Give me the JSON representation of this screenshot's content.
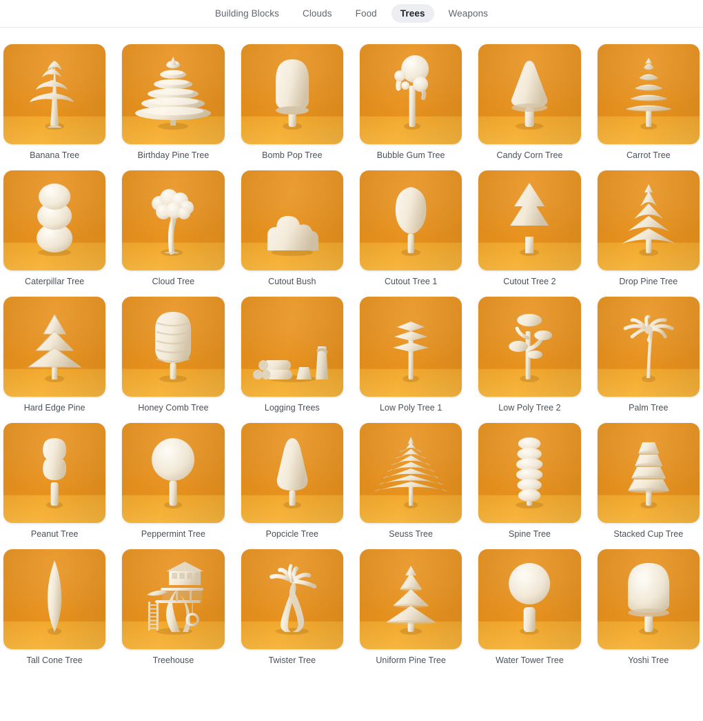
{
  "tabs": [
    {
      "label": "Building Blocks",
      "active": false
    },
    {
      "label": "Clouds",
      "active": false
    },
    {
      "label": "Food",
      "active": false
    },
    {
      "label": "Trees",
      "active": true
    },
    {
      "label": "Weapons",
      "active": false
    }
  ],
  "colors": {
    "thumb_back_wall": "#e8921e",
    "thumb_floor": "#f7b63f",
    "object_cream": "#f2e8d5",
    "active_tab_bg": "#eceef1",
    "active_tab_text": "#1d2129",
    "tab_text": "#5f6672",
    "caption_text": "#4a5057",
    "page_bg": "#ffffff",
    "divider": "#e9eaec"
  },
  "grid": {
    "columns": 6,
    "rows": 5,
    "count": 30,
    "items": [
      {
        "label": "Banana Tree",
        "icon": "banana-tree-3d-render"
      },
      {
        "label": "Birthday Pine Tree",
        "icon": "birthday-pine-tree-3d-render"
      },
      {
        "label": "Bomb Pop Tree",
        "icon": "bomb-pop-tree-3d-render"
      },
      {
        "label": "Bubble Gum Tree",
        "icon": "bubble-gum-tree-3d-render"
      },
      {
        "label": "Candy Corn Tree",
        "icon": "candy-corn-tree-3d-render"
      },
      {
        "label": "Carrot Tree",
        "icon": "carrot-tree-3d-render"
      },
      {
        "label": "Caterpillar Tree",
        "icon": "caterpillar-tree-3d-render"
      },
      {
        "label": "Cloud Tree",
        "icon": "cloud-tree-3d-render"
      },
      {
        "label": "Cutout Bush",
        "icon": "cutout-bush-3d-render"
      },
      {
        "label": "Cutout Tree 1",
        "icon": "cutout-tree-1-3d-render"
      },
      {
        "label": "Cutout Tree 2",
        "icon": "cutout-tree-2-3d-render"
      },
      {
        "label": "Drop Pine Tree",
        "icon": "drop-pine-tree-3d-render"
      },
      {
        "label": "Hard Edge Pine",
        "icon": "hard-edge-pine-3d-render"
      },
      {
        "label": "Honey Comb Tree",
        "icon": "honey-comb-tree-3d-render"
      },
      {
        "label": "Logging Trees",
        "icon": "logging-trees-3d-render"
      },
      {
        "label": "Low Poly Tree 1",
        "icon": "low-poly-tree-1-3d-render"
      },
      {
        "label": "Low Poly Tree 2",
        "icon": "low-poly-tree-2-3d-render"
      },
      {
        "label": "Palm Tree",
        "icon": "palm-tree-3d-render"
      },
      {
        "label": "Peanut Tree",
        "icon": "peanut-tree-3d-render"
      },
      {
        "label": "Peppermint Tree",
        "icon": "peppermint-tree-3d-render"
      },
      {
        "label": "Popcicle Tree",
        "icon": "popcicle-tree-3d-render"
      },
      {
        "label": "Seuss Tree",
        "icon": "seuss-tree-3d-render"
      },
      {
        "label": "Spine Tree",
        "icon": "spine-tree-3d-render"
      },
      {
        "label": "Stacked Cup Tree",
        "icon": "stacked-cup-tree-3d-render"
      },
      {
        "label": "Tall Cone Tree",
        "icon": "tall-cone-tree-3d-render"
      },
      {
        "label": "Treehouse",
        "icon": "treehouse-3d-render"
      },
      {
        "label": "Twister Tree",
        "icon": "twister-tree-3d-render"
      },
      {
        "label": "Uniform Pine Tree",
        "icon": "uniform-pine-tree-3d-render"
      },
      {
        "label": "Water Tower Tree",
        "icon": "water-tower-tree-3d-render"
      },
      {
        "label": "Yoshi Tree",
        "icon": "yoshi-tree-3d-render"
      }
    ]
  }
}
